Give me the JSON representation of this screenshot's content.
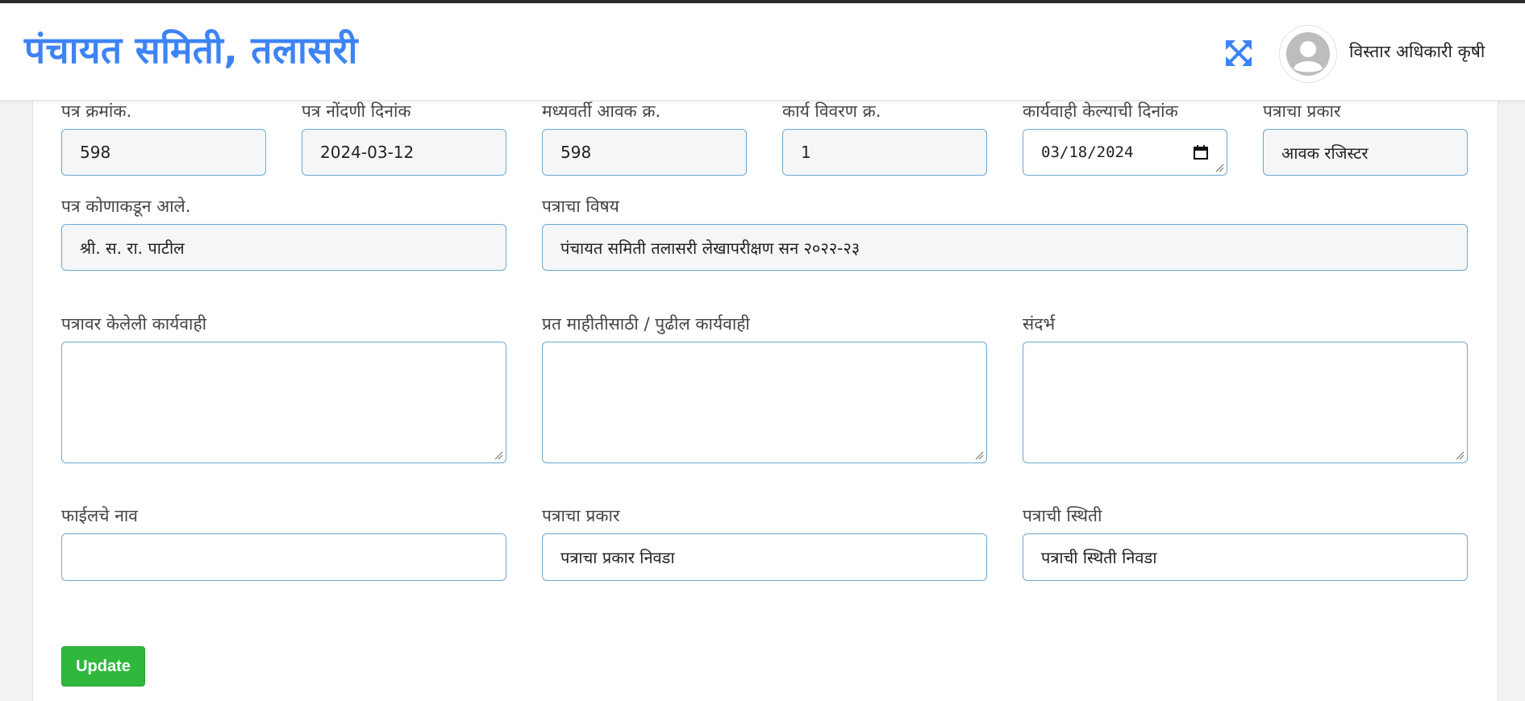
{
  "header": {
    "brand": "पंचायत समिती, तलासरी",
    "user_name": "विस्तार अधिकारी कृषी"
  },
  "form": {
    "letter_no": {
      "label": "पत्र क्रमांक.",
      "value": "598"
    },
    "registration_date": {
      "label": "पत्र नोंदणी दिनांक",
      "value": "2024-03-12"
    },
    "central_inward_no": {
      "label": "मध्यवर्ती आवक क्र.",
      "value": "598"
    },
    "work_detail_no": {
      "label": "कार्य विवरण क्र.",
      "value": "1"
    },
    "action_date": {
      "label": "कार्यवाही केल्याची दिनांक",
      "value": "03/18/2024"
    },
    "letter_type_top": {
      "label": "पत्राचा प्रकार",
      "value": "आवक रजिस्टर"
    },
    "from_whom": {
      "label": "पत्र कोणाकडून आले.",
      "value": "श्री. स. रा. पाटील"
    },
    "subject": {
      "label": "पत्राचा विषय",
      "value": "पंचायत समिती तलासरी लेखापरीक्षण सन २०२२-२३"
    },
    "action_taken": {
      "label": "पत्रावर केलेली कार्यवाही",
      "value": ""
    },
    "copy_for_info": {
      "label": "प्रत माहीतीसाठी / पुढील कार्यवाही",
      "value": ""
    },
    "reference": {
      "label": "संदर्भ",
      "value": ""
    },
    "file_name": {
      "label": "फाईलचे नाव",
      "value": ""
    },
    "letter_type": {
      "label": "पत्राचा प्रकार",
      "value": "पत्राचा प्रकार निवडा"
    },
    "letter_status": {
      "label": "पत्राची स्थिती",
      "value": "पत्राची स्थिती निवडा"
    }
  },
  "buttons": {
    "update": "Update"
  },
  "colors": {
    "brand": "#3d83f5",
    "update_button": "#2fb83c",
    "input_border": "#6fa7cf"
  },
  "icons": {
    "expand": "expand-arrows-icon",
    "avatar": "user-avatar-icon",
    "calendar": "calendar-icon"
  }
}
